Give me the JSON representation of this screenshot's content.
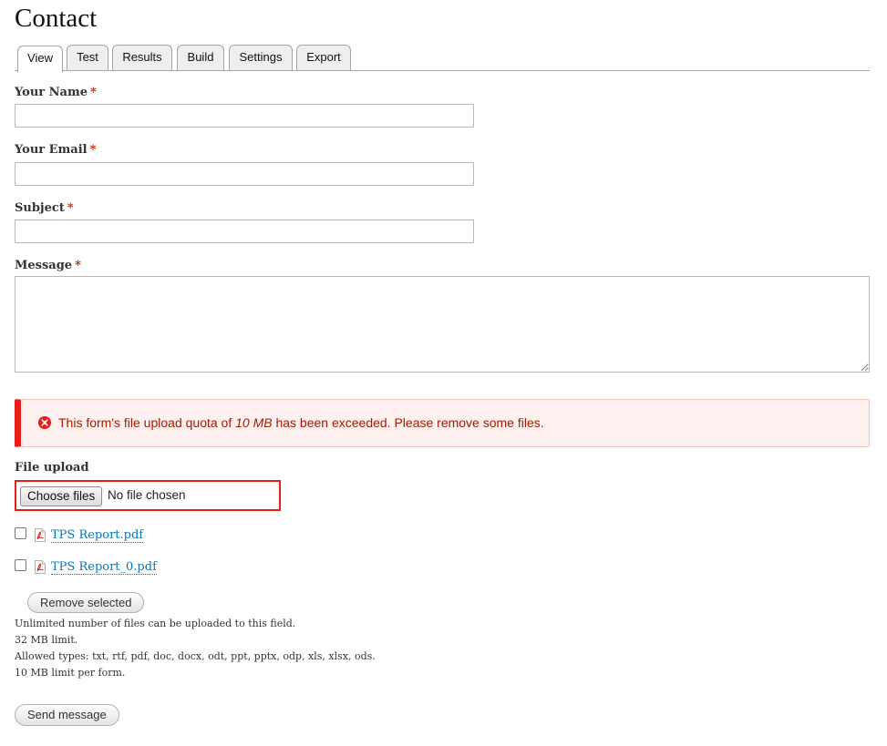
{
  "page": {
    "title": "Contact"
  },
  "tabs": [
    {
      "label": "View",
      "active": true
    },
    {
      "label": "Test"
    },
    {
      "label": "Results"
    },
    {
      "label": "Build"
    },
    {
      "label": "Settings"
    },
    {
      "label": "Export"
    }
  ],
  "form": {
    "name": {
      "label": "Your Name",
      "required_mark": "*",
      "value": ""
    },
    "email": {
      "label": "Your Email",
      "required_mark": "*",
      "value": ""
    },
    "subject": {
      "label": "Subject",
      "required_mark": "*",
      "value": ""
    },
    "message": {
      "label": "Message",
      "required_mark": "*",
      "value": ""
    }
  },
  "error": {
    "text_before": "This form's file upload quota of ",
    "quota": "10 MB",
    "text_after": " has been exceeded. Please remove some files.",
    "color": "#e61e17"
  },
  "file_upload": {
    "label": "File upload",
    "choose_label": "Choose files",
    "status": "No file chosen",
    "files": [
      {
        "name": "TPS Report.pdf",
        "checked": false,
        "icon": "pdf-file-icon"
      },
      {
        "name": "TPS Report_0.pdf",
        "checked": false,
        "icon": "pdf-file-icon"
      }
    ],
    "remove_label": "Remove selected",
    "descriptions": [
      "Unlimited number of files can be uploaded to this field.",
      "32 MB limit.",
      "Allowed types: txt, rtf, pdf, doc, docx, odt, ppt, pptx, odp, xls, xlsx, ods.",
      "10 MB limit per form."
    ]
  },
  "submit": {
    "label": "Send message"
  },
  "colors": {
    "link": "#0678be",
    "required": "#cc2200",
    "error_text": "#a51b00"
  }
}
